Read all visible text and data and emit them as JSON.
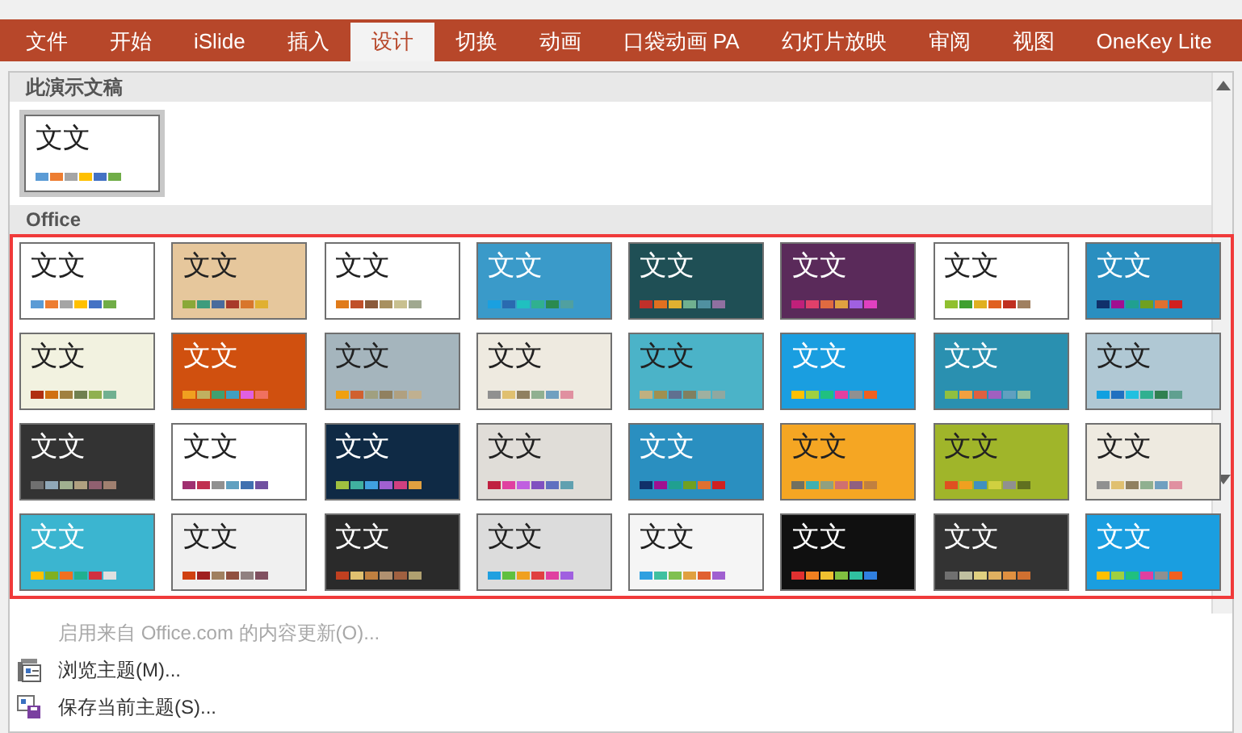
{
  "ribbon_tabs": [
    {
      "label": "文件",
      "selected": false
    },
    {
      "label": "开始",
      "selected": false
    },
    {
      "label": "iSlide",
      "selected": false
    },
    {
      "label": "插入",
      "selected": false
    },
    {
      "label": "设计",
      "selected": true
    },
    {
      "label": "切换",
      "selected": false
    },
    {
      "label": "动画",
      "selected": false
    },
    {
      "label": "口袋动画 PA",
      "selected": false
    },
    {
      "label": "幻灯片放映",
      "selected": false
    },
    {
      "label": "审阅",
      "selected": false
    },
    {
      "label": "视图",
      "selected": false
    },
    {
      "label": "OneKey Lite",
      "selected": false
    }
  ],
  "theme_gallery": {
    "current_section": {
      "heading": "此演示文稿",
      "themes": [
        {
          "text": "文文",
          "selected": true,
          "color": "#ffffff",
          "swatches": [
            {
              "color": "#5b9bd5"
            },
            {
              "color": "#ed7d31"
            },
            {
              "color": "#a5a5a5"
            },
            {
              "color": "#ffc000"
            },
            {
              "color": "#4472c4"
            },
            {
              "color": "#70ad47"
            }
          ]
        }
      ]
    },
    "office_section": {
      "heading": "Office",
      "themes": [
        {
          "text": "文文",
          "selected": false,
          "color": "#ffffff",
          "swatches": [
            {
              "color": "#5b9bd5"
            },
            {
              "color": "#ed7d31"
            },
            {
              "color": "#a5a5a5"
            },
            {
              "color": "#ffc000"
            },
            {
              "color": "#4472c4"
            },
            {
              "color": "#70ad47"
            }
          ]
        },
        {
          "text": "文文",
          "selected": false,
          "color": "#e6c79c",
          "swatches": [
            {
              "color": "#8aa838"
            },
            {
              "color": "#3f9c7d"
            },
            {
              "color": "#4a6b9c"
            },
            {
              "color": "#a83a2a"
            },
            {
              "color": "#d8762c"
            },
            {
              "color": "#e0b030"
            }
          ]
        },
        {
          "text": "文文",
          "selected": false,
          "color": "#ffffff",
          "swatches": [
            {
              "color": "#e07b1a"
            },
            {
              "color": "#c0502a"
            },
            {
              "color": "#8a5a3a"
            },
            {
              "color": "#a89060"
            },
            {
              "color": "#c8c090"
            },
            {
              "color": "#a0a890"
            }
          ]
        },
        {
          "text": "文文",
          "selected": false,
          "color": "#3a9ac9",
          "swatches": [
            {
              "color": "#1aa0e0"
            },
            {
              "color": "#2a6ab0"
            },
            {
              "color": "#20c0c0"
            },
            {
              "color": "#30b090"
            },
            {
              "color": "#2a8a50"
            },
            {
              "color": "#50a0a0"
            }
          ]
        },
        {
          "text": "文文",
          "selected": false,
          "color": "#1f4f55",
          "swatches": [
            {
              "color": "#c0302a"
            },
            {
              "color": "#e07020"
            },
            {
              "color": "#e0b030"
            },
            {
              "color": "#70b090"
            },
            {
              "color": "#5090a0"
            },
            {
              "color": "#9070a0"
            }
          ]
        },
        {
          "text": "文文",
          "selected": false,
          "color": "#5a2a5a",
          "swatches": [
            {
              "color": "#c0207a"
            },
            {
              "color": "#e0406a"
            },
            {
              "color": "#e06a40"
            },
            {
              "color": "#e0a040"
            },
            {
              "color": "#a060e0"
            },
            {
              "color": "#e040c0"
            }
          ]
        },
        {
          "text": "文文",
          "selected": false,
          "color": "#ffffff",
          "swatches": [
            {
              "color": "#90c030"
            },
            {
              "color": "#40a030"
            },
            {
              "color": "#e0b020"
            },
            {
              "color": "#e06020"
            },
            {
              "color": "#c03020"
            },
            {
              "color": "#a08060"
            }
          ]
        },
        {
          "text": "文文",
          "selected": false,
          "color": "#2a8fc0",
          "swatches": [
            {
              "color": "#10306a"
            },
            {
              "color": "#a01090"
            },
            {
              "color": "#20a090"
            },
            {
              "color": "#70a020"
            },
            {
              "color": "#e07030"
            },
            {
              "color": "#d02020"
            }
          ]
        },
        {
          "text": "文文",
          "selected": false,
          "color": "#f2f2e0",
          "swatches": [
            {
              "color": "#b03010"
            },
            {
              "color": "#d07010"
            },
            {
              "color": "#a08040"
            },
            {
              "color": "#708050"
            },
            {
              "color": "#90b050"
            },
            {
              "color": "#70b090"
            }
          ]
        },
        {
          "text": "文文",
          "selected": false,
          "color": "#d0500f",
          "swatches": [
            {
              "color": "#f0a020"
            },
            {
              "color": "#c0b060"
            },
            {
              "color": "#40a070"
            },
            {
              "color": "#40a0c0"
            },
            {
              "color": "#e060e0"
            },
            {
              "color": "#f07060"
            }
          ]
        },
        {
          "text": "文文",
          "selected": false,
          "color": "#a5b5bd",
          "swatches": [
            {
              "color": "#f0a010"
            },
            {
              "color": "#d06030"
            },
            {
              "color": "#a0a080"
            },
            {
              "color": "#908060"
            },
            {
              "color": "#b0a080"
            },
            {
              "color": "#c0b090"
            }
          ]
        },
        {
          "text": "文文",
          "selected": false,
          "color": "#eeeae0",
          "swatches": [
            {
              "color": "#909090"
            },
            {
              "color": "#e0c070"
            },
            {
              "color": "#908060"
            },
            {
              "color": "#90b090"
            },
            {
              "color": "#70a0c0"
            },
            {
              "color": "#e090a0"
            }
          ]
        },
        {
          "text": "文文",
          "selected": false,
          "color": "#4bb3c8",
          "swatches": [
            {
              "color": "#c0b080"
            },
            {
              "color": "#a09050"
            },
            {
              "color": "#607090"
            },
            {
              "color": "#808060"
            },
            {
              "color": "#a0b0a0"
            },
            {
              "color": "#90a8a0"
            }
          ]
        },
        {
          "text": "文文",
          "selected": false,
          "color": "#1a9ee0",
          "swatches": [
            {
              "color": "#ffc000"
            },
            {
              "color": "#a0d040"
            },
            {
              "color": "#20c080"
            },
            {
              "color": "#e040a0"
            },
            {
              "color": "#909090"
            },
            {
              "color": "#f06020"
            }
          ]
        },
        {
          "text": "文文",
          "selected": false,
          "color": "#2a90b0",
          "swatches": [
            {
              "color": "#90c040"
            },
            {
              "color": "#f0a040"
            },
            {
              "color": "#e06040"
            },
            {
              "color": "#a060c0"
            },
            {
              "color": "#60a0c0"
            },
            {
              "color": "#90c0a0"
            }
          ]
        },
        {
          "text": "文文",
          "selected": false,
          "color": "#b0c8d4",
          "swatches": [
            {
              "color": "#10a0e0"
            },
            {
              "color": "#2070c0"
            },
            {
              "color": "#20c0e0"
            },
            {
              "color": "#30b090"
            },
            {
              "color": "#308050"
            },
            {
              "color": "#60a090"
            }
          ]
        },
        {
          "text": "文文",
          "selected": false,
          "color": "#333333",
          "swatches": [
            {
              "color": "#707070"
            },
            {
              "color": "#90a8b8"
            },
            {
              "color": "#a0b090"
            },
            {
              "color": "#b0a080"
            },
            {
              "color": "#906070"
            },
            {
              "color": "#a08070"
            }
          ]
        },
        {
          "text": "文文",
          "selected": false,
          "color": "#ffffff",
          "swatches": [
            {
              "color": "#a03070"
            },
            {
              "color": "#c03050"
            },
            {
              "color": "#909090"
            },
            {
              "color": "#60a0c0"
            },
            {
              "color": "#4070b0"
            },
            {
              "color": "#7050a0"
            }
          ]
        },
        {
          "text": "文文",
          "selected": false,
          "color": "#0f2a45",
          "swatches": [
            {
              "color": "#a0c040"
            },
            {
              "color": "#40b0a0"
            },
            {
              "color": "#40a0e0"
            },
            {
              "color": "#a060d0"
            },
            {
              "color": "#d04080"
            },
            {
              "color": "#e0a040"
            }
          ]
        },
        {
          "text": "文文",
          "selected": false,
          "color": "#e0ddd8",
          "swatches": [
            {
              "color": "#c02040"
            },
            {
              "color": "#e040a0"
            },
            {
              "color": "#c060e0"
            },
            {
              "color": "#8050c0"
            },
            {
              "color": "#6070c0"
            },
            {
              "color": "#60a0b0"
            }
          ]
        },
        {
          "text": "文文",
          "selected": false,
          "color": "#2a8fc0",
          "swatches": [
            {
              "color": "#10306a"
            },
            {
              "color": "#a01090"
            },
            {
              "color": "#20a090"
            },
            {
              "color": "#70a020"
            },
            {
              "color": "#e07030"
            },
            {
              "color": "#d02020"
            }
          ]
        },
        {
          "text": "文文",
          "selected": false,
          "color": "#f5a623",
          "swatches": [
            {
              "color": "#707060"
            },
            {
              "color": "#40b0b0"
            },
            {
              "color": "#90a080"
            },
            {
              "color": "#d07070"
            },
            {
              "color": "#906080"
            },
            {
              "color": "#c08040"
            }
          ]
        },
        {
          "text": "文文",
          "selected": false,
          "color": "#a0b52a",
          "swatches": [
            {
              "color": "#e05020"
            },
            {
              "color": "#f0a020"
            },
            {
              "color": "#4090c0"
            },
            {
              "color": "#d0d040"
            },
            {
              "color": "#909090"
            },
            {
              "color": "#607020"
            }
          ]
        },
        {
          "text": "文文",
          "selected": false,
          "color": "#eeeae0",
          "swatches": [
            {
              "color": "#909090"
            },
            {
              "color": "#e0c070"
            },
            {
              "color": "#908060"
            },
            {
              "color": "#90b090"
            },
            {
              "color": "#70a0c0"
            },
            {
              "color": "#e090a0"
            }
          ]
        },
        {
          "text": "文文",
          "selected": false,
          "color": "#3bb5d0",
          "swatches": [
            {
              "color": "#ffc000"
            },
            {
              "color": "#80b020"
            },
            {
              "color": "#f07020"
            },
            {
              "color": "#20b090"
            },
            {
              "color": "#d03040"
            },
            {
              "color": "#e0e0e0"
            }
          ]
        },
        {
          "text": "文文",
          "selected": false,
          "color": "#f0f0f0",
          "swatches": [
            {
              "color": "#d04010"
            },
            {
              "color": "#a02020"
            },
            {
              "color": "#a08060"
            },
            {
              "color": "#905040"
            },
            {
              "color": "#908080"
            },
            {
              "color": "#805060"
            }
          ]
        },
        {
          "text": "文文",
          "selected": false,
          "color": "#2a2a2a",
          "swatches": [
            {
              "color": "#c04020"
            },
            {
              "color": "#e0c070"
            },
            {
              "color": "#c08040"
            },
            {
              "color": "#b09070"
            },
            {
              "color": "#a06040"
            },
            {
              "color": "#b0a070"
            }
          ]
        },
        {
          "text": "文文",
          "selected": false,
          "color": "#dcdcdc",
          "swatches": [
            {
              "color": "#20a0e0"
            },
            {
              "color": "#60c040"
            },
            {
              "color": "#f0a020"
            },
            {
              "color": "#e04040"
            },
            {
              "color": "#e040a0"
            },
            {
              "color": "#a060e0"
            }
          ]
        },
        {
          "text": "文文",
          "selected": false,
          "color": "#f5f5f5",
          "swatches": [
            {
              "color": "#30a0e0"
            },
            {
              "color": "#40c0a0"
            },
            {
              "color": "#80c050"
            },
            {
              "color": "#e0a040"
            },
            {
              "color": "#e06030"
            },
            {
              "color": "#a060d0"
            }
          ]
        },
        {
          "text": "文文",
          "selected": false,
          "color": "#101010",
          "swatches": [
            {
              "color": "#e03030"
            },
            {
              "color": "#f08020"
            },
            {
              "color": "#f0c030"
            },
            {
              "color": "#80c040"
            },
            {
              "color": "#30c0a0"
            },
            {
              "color": "#3080e0"
            }
          ]
        },
        {
          "text": "文文",
          "selected": false,
          "color": "#333333",
          "swatches": [
            {
              "color": "#707070"
            },
            {
              "color": "#c0c0a0"
            },
            {
              "color": "#e0d080"
            },
            {
              "color": "#e0b060"
            },
            {
              "color": "#e09040"
            },
            {
              "color": "#d07030"
            }
          ]
        },
        {
          "text": "文文",
          "selected": false,
          "color": "#1a9ee0",
          "swatches": [
            {
              "color": "#ffc000"
            },
            {
              "color": "#a0d040"
            },
            {
              "color": "#20c080"
            },
            {
              "color": "#e040a0"
            },
            {
              "color": "#909090"
            },
            {
              "color": "#f06020"
            }
          ]
        }
      ]
    }
  },
  "menu": [
    {
      "label": "启用来自 Office.com 的内容更新(O)...",
      "kind": "plain",
      "disabled": true
    },
    {
      "label": "浏览主题(M)...",
      "kind": "browse",
      "disabled": false
    },
    {
      "label": "保存当前主题(S)...",
      "kind": "save",
      "disabled": false
    }
  ]
}
